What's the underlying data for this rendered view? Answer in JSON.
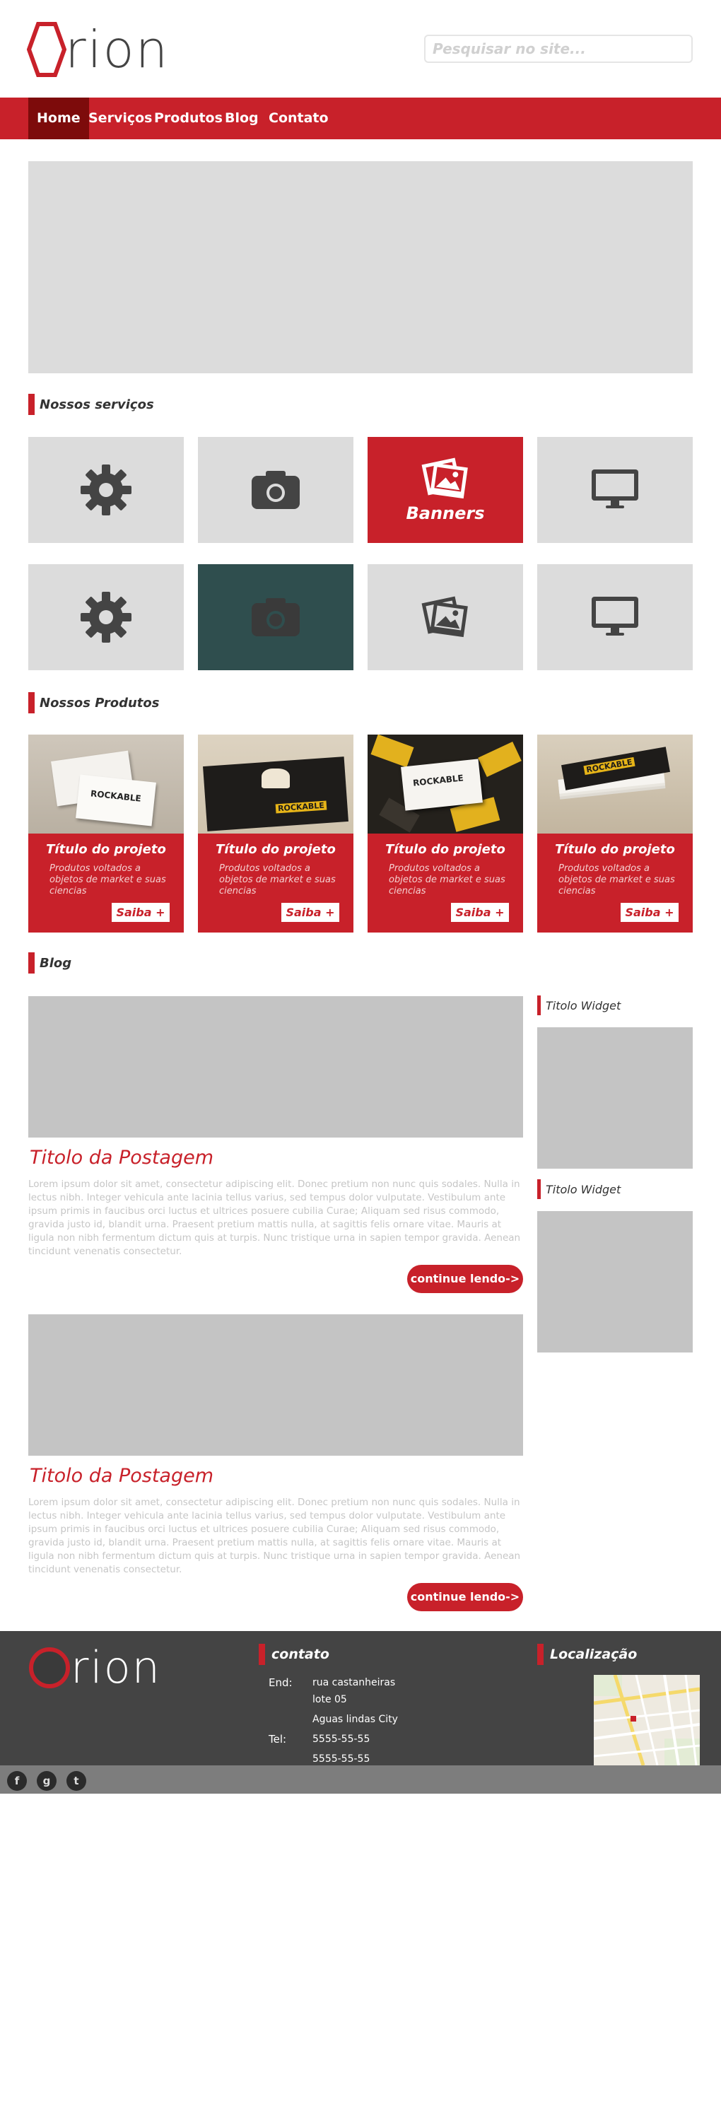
{
  "brand": {
    "name": "rion",
    "accent": "#c8212a",
    "dark_red": "#7d0b0b"
  },
  "search": {
    "placeholder": "Pesquisar no site..."
  },
  "nav": {
    "items": [
      {
        "label": "Home",
        "active": true
      },
      {
        "label": "Serviços",
        "active": false
      },
      {
        "label": "Produtos",
        "active": false
      },
      {
        "label": "Blog",
        "active": false
      },
      {
        "label": "Contato",
        "active": false
      }
    ]
  },
  "services": {
    "title": "Nossos serviços",
    "tiles": [
      {
        "icon": "gear-icon"
      },
      {
        "icon": "camera-icon"
      },
      {
        "icon": "photos-icon",
        "label": "Banners"
      },
      {
        "icon": "monitor-icon"
      },
      {
        "icon": "gear-icon"
      },
      {
        "icon": "camera-icon"
      },
      {
        "icon": "photos-icon"
      },
      {
        "icon": "monitor-icon"
      }
    ]
  },
  "products": {
    "title": "Nossos Produtos",
    "items": [
      {
        "title": "Título do projeto",
        "desc": "Produtos voltados a objetos de market e suas ciencias",
        "button": "Saiba +",
        "brand_text": "ROCKABLE"
      },
      {
        "title": "Título do projeto",
        "desc": "Produtos voltados a objetos de market e suas ciencias",
        "button": "Saiba +",
        "brand_text": "ROCKABLE"
      },
      {
        "title": "Título do projeto",
        "desc": "Produtos voltados a objetos de market e suas ciencias",
        "button": "Saiba +",
        "brand_text": "ROCKABLE"
      },
      {
        "title": "Título do projeto",
        "desc": "Produtos voltados a objetos de market e suas ciencias",
        "button": "Saiba +",
        "brand_text": "ROCKABLE"
      }
    ]
  },
  "blog": {
    "title": "Blog",
    "posts": [
      {
        "title": "Titolo da Postagem",
        "text": "Lorem ipsum dolor sit amet, consectetur adipiscing elit. Donec pretium non nunc quis sodales. Nulla in lectus nibh. Integer vehicula ante lacinia tellus varius, sed tempus dolor vulputate. Vestibulum ante ipsum primis in faucibus orci luctus et ultrices posuere cubilia Curae; Aliquam sed risus commodo, gravida justo id, blandit urna. Praesent pretium mattis nulla, at sagittis felis ornare vitae. Mauris at ligula non nibh fermentum dictum quis at turpis. Nunc tristique urna in sapien tempor gravida. Aenean tincidunt venenatis consectetur.",
        "button": "continue lendo->"
      },
      {
        "title": "Titolo da Postagem",
        "text": "Lorem ipsum dolor sit amet, consectetur adipiscing elit. Donec pretium non nunc quis sodales. Nulla in lectus nibh. Integer vehicula ante lacinia tellus varius, sed tempus dolor vulputate. Vestibulum ante ipsum primis in faucibus orci luctus et ultrices posuere cubilia Curae; Aliquam sed risus commodo, gravida justo id, blandit urna. Praesent pretium mattis nulla, at sagittis felis ornare vitae. Mauris at ligula non nibh fermentum dictum quis at turpis. Nunc tristique urna in sapien tempor gravida. Aenean tincidunt venenatis consectetur.",
        "button": "continue lendo->"
      }
    ],
    "widgets": [
      {
        "title": "Titolo Widget"
      },
      {
        "title": "Titolo Widget"
      }
    ]
  },
  "footer": {
    "contact_title": "contato",
    "address_label": "End:",
    "address_line1": "rua castanheiras",
    "address_line2": "lote 05",
    "address_line3": "Aguas lindas City",
    "tel_label": "Tel:",
    "tel1": "5555-55-55",
    "tel2": "5555-55-55",
    "location_title": "Localização"
  },
  "social": [
    {
      "icon": "facebook-icon",
      "glyph": "f"
    },
    {
      "icon": "google-icon",
      "glyph": "g"
    },
    {
      "icon": "twitter-icon",
      "glyph": "t"
    }
  ]
}
